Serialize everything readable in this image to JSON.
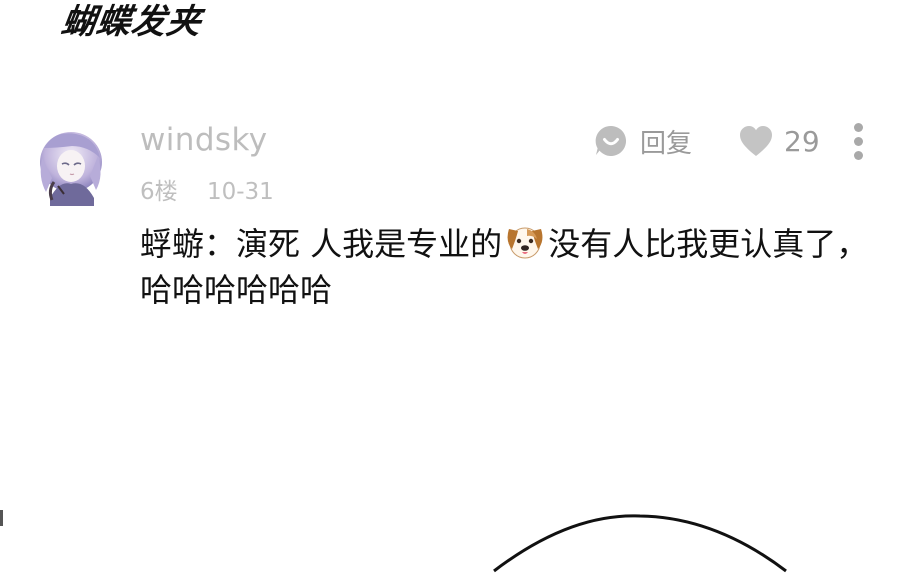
{
  "page": {
    "title": "蝴蝶发夹"
  },
  "comment": {
    "username": "windsky",
    "floor": "6楼",
    "date": "10-31",
    "text_before_emoji": "蜉蝣：演死 人我是专业的",
    "text_after_emoji": "没有人比我更认真了，哈哈哈哈哈哈",
    "emoji_icon": "dog-face-icon",
    "reply_label": "回复",
    "reply_icon": "speech-bubble-icon",
    "like_count": "29",
    "like_icon": "heart-icon",
    "more_icon": "vertical-ellipsis-icon"
  },
  "colors": {
    "text_primary": "#111111",
    "text_secondary": "#bdbdbd",
    "icon_gray": "#a9a9a9"
  }
}
